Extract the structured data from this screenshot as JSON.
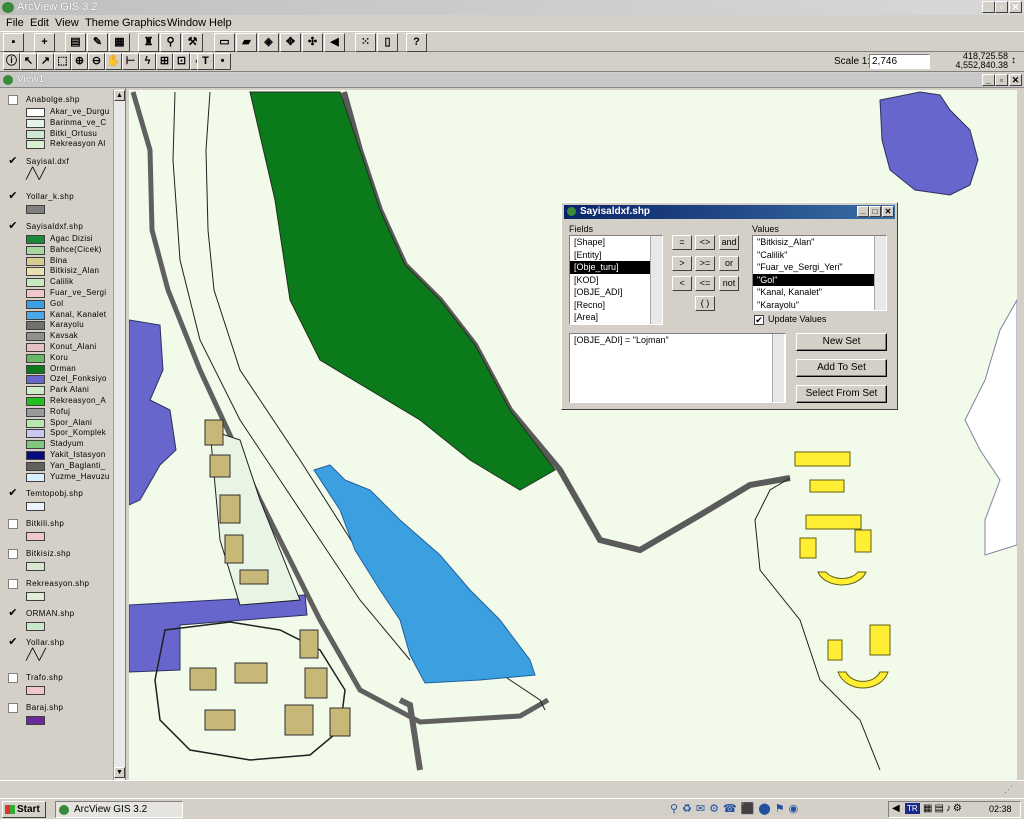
{
  "app": {
    "title": "ArcView GIS 3.2"
  },
  "menu": [
    "File",
    "Edit",
    "View",
    "Theme",
    "Graphics",
    "Window",
    "Help"
  ],
  "scale": {
    "label": "Scale 1:",
    "value": "2,746",
    "coord_x": "418,725.58",
    "coord_y": "4,552,840.38"
  },
  "view": {
    "title": "View1"
  },
  "toc": [
    {
      "name": "Anabolge.shp",
      "checked": false,
      "legend": [
        {
          "label": "Akar_ve_Durgu",
          "color": "#ffffff"
        },
        {
          "label": "Barinma_ve_C",
          "color": "#e4f4ec"
        },
        {
          "label": "Bitki_Ortusu",
          "color": "#cfe8d4"
        },
        {
          "label": "Rekreasyon Al",
          "color": "#d8efd0"
        }
      ]
    },
    {
      "name": "Sayisal.dxf",
      "checked": true,
      "line": true
    },
    {
      "name": "Yollar_k.shp",
      "checked": true,
      "legend": [
        {
          "label": "",
          "color": "#808080"
        }
      ]
    },
    {
      "name": "Sayisaldxf.shp",
      "checked": true,
      "legend": [
        {
          "label": "Agac Dizisi",
          "color": "#1a8a3a"
        },
        {
          "label": "Bahce(Cicek)",
          "color": "#a8d8a0"
        },
        {
          "label": "Bina",
          "color": "#d8cc90"
        },
        {
          "label": "Bitkisiz_Alan",
          "color": "#e8e0b0"
        },
        {
          "label": "Calilik",
          "color": "#c8e8c0"
        },
        {
          "label": "Fuar_ve_Sergi",
          "color": "#f0c8c8"
        },
        {
          "label": "Gol",
          "color": "#3ca0e0"
        },
        {
          "label": "Kanal, Kanalet",
          "color": "#4aa8e8"
        },
        {
          "label": "Karayolu",
          "color": "#707070"
        },
        {
          "label": "Kavsak",
          "color": "#909090"
        },
        {
          "label": "Konut_Alani",
          "color": "#e8c0c0"
        },
        {
          "label": "Koru",
          "color": "#68b868"
        },
        {
          "label": "Orman",
          "color": "#0a7a1a"
        },
        {
          "label": "Ozel_Fonksiyo",
          "color": "#6666cc"
        },
        {
          "label": "Park Alani",
          "color": "#d0ecc8"
        },
        {
          "label": "Rekreasyon_A",
          "color": "#20c020"
        },
        {
          "label": "Rofuj",
          "color": "#9a9a9a"
        },
        {
          "label": "Spor_Alani",
          "color": "#b8e8b0"
        },
        {
          "label": "Spor_Komplek",
          "color": "#c8c8f0"
        },
        {
          "label": "Stadyum",
          "color": "#80c880"
        },
        {
          "label": "Yakit_Istasyon",
          "color": "#0a0a80"
        },
        {
          "label": "Yan_Baglanti_",
          "color": "#606060"
        },
        {
          "label": "Yuzme_Havuzu",
          "color": "#d8f0ff"
        }
      ]
    },
    {
      "name": "Temtopobj.shp",
      "checked": true,
      "legend": [
        {
          "label": "",
          "color": "#eef4ff"
        }
      ]
    },
    {
      "name": "Bitkili.shp",
      "checked": false,
      "legend": [
        {
          "label": "",
          "color": "#f0c8c8"
        }
      ]
    },
    {
      "name": "Bitkisiz.shp",
      "checked": false,
      "legend": [
        {
          "label": "",
          "color": "#d8e8d0"
        }
      ]
    },
    {
      "name": "Rekreasyon.shp",
      "checked": false,
      "legend": [
        {
          "label": "",
          "color": "#e0ecd8"
        }
      ]
    },
    {
      "name": "ORMAN.shp",
      "checked": true,
      "legend": [
        {
          "label": "",
          "color": "#c8e8c8"
        }
      ]
    },
    {
      "name": "Yollar.shp",
      "checked": true,
      "line": true
    },
    {
      "name": "Trafo.shp",
      "checked": false,
      "legend": [
        {
          "label": "",
          "color": "#f0c8c8"
        }
      ]
    },
    {
      "name": "Baraj.shp",
      "checked": false,
      "legend": [
        {
          "label": "",
          "color": "#6a2a9a"
        }
      ]
    }
  ],
  "dialog": {
    "title": "Sayisaldxf.shp",
    "fields_label": "Fields",
    "values_label": "Values",
    "fields": [
      "[Shape]",
      "[Entity]",
      "[Obje_turu]",
      "[KOD]",
      "[OBJE_ADI]",
      "[Recno]",
      "[Area]"
    ],
    "fields_selected": 2,
    "values": [
      "\"Bitkisiz_Alan\"",
      "\"Calilik\"",
      "\"Fuar_ve_Sergi_Yeri\"",
      "\"Gol\"",
      "\"Kanal, Kanalet\"",
      "\"Karayolu\""
    ],
    "values_selected": 3,
    "operators": [
      "=",
      "<>",
      "and",
      ">",
      ">=",
      "or",
      "<",
      "<=",
      "not",
      "( )"
    ],
    "update_label": "Update Values",
    "update_checked": true,
    "expression": "[OBJE_ADI] = \"Lojman\"",
    "buttons": [
      "New Set",
      "Add To Set",
      "Select From Set"
    ]
  },
  "taskbar": {
    "start": "Start",
    "task": "ArcView GIS 3.2",
    "lang": "TR",
    "clock": "02:38"
  }
}
